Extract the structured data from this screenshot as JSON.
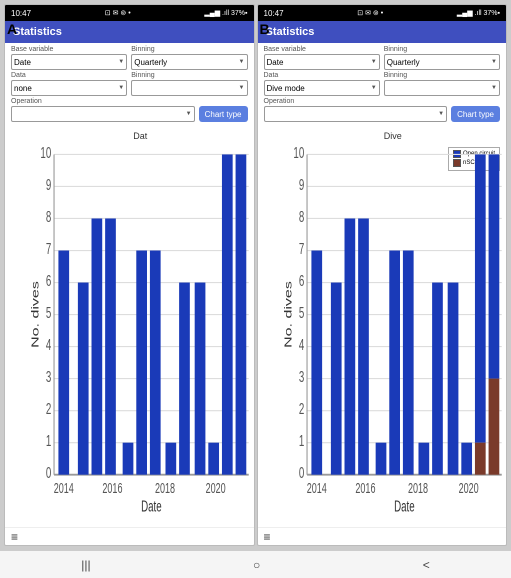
{
  "panels": [
    {
      "label": "A",
      "statusBar": {
        "time": "10:47",
        "icons": "⊡ ✉ ⊚",
        "signal": "📶 37%"
      },
      "titleBar": "Statistics",
      "controls": {
        "baseVariableLabel": "Base variable",
        "baseVariableValue": "Date",
        "binningLabel1": "Binning",
        "binningValue1": "Quarterly",
        "dataLabel": "Data",
        "dataValue": "none",
        "binningLabel2": "Binning",
        "binningValue2": "",
        "operationLabel": "Operation",
        "operationValue": "",
        "chartTypeBtn": "Chart type"
      },
      "chart": {
        "title": "Dat",
        "xLabel": "Date",
        "yLabel": "No. dives",
        "yMax": 10,
        "xLabels": [
          "2014",
          "2016",
          "2018",
          "2020",
          ""
        ],
        "bars": [
          {
            "x": 0.05,
            "height": 0.7,
            "color": "#1a3ab8"
          },
          {
            "x": 0.15,
            "height": 0.6,
            "color": "#1a3ab8"
          },
          {
            "x": 0.22,
            "height": 0.8,
            "color": "#1a3ab8"
          },
          {
            "x": 0.29,
            "height": 0.8,
            "color": "#1a3ab8"
          },
          {
            "x": 0.38,
            "height": 0.1,
            "color": "#1a3ab8"
          },
          {
            "x": 0.45,
            "height": 0.7,
            "color": "#1a3ab8"
          },
          {
            "x": 0.52,
            "height": 0.7,
            "color": "#1a3ab8"
          },
          {
            "x": 0.6,
            "height": 0.1,
            "color": "#1a3ab8"
          },
          {
            "x": 0.67,
            "height": 0.6,
            "color": "#1a3ab8"
          },
          {
            "x": 0.75,
            "height": 0.6,
            "color": "#1a3ab8"
          },
          {
            "x": 0.82,
            "height": 0.1,
            "color": "#1a3ab8"
          },
          {
            "x": 0.89,
            "height": 1.0,
            "color": "#1a3ab8"
          },
          {
            "x": 0.96,
            "height": 1.0,
            "color": "#1a3ab8"
          }
        ],
        "showLegend": false
      }
    },
    {
      "label": "B",
      "statusBar": {
        "time": "10:47",
        "icons": "⊡ ✉ ⊚",
        "signal": "📶 37%"
      },
      "titleBar": "Statistics",
      "controls": {
        "baseVariableLabel": "Base variable",
        "baseVariableValue": "Date",
        "binningLabel1": "Binning",
        "binningValue1": "Quarterly",
        "dataLabel": "Data",
        "dataValue": "Dive mode",
        "binningLabel2": "Binning",
        "binningValue2": "",
        "operationLabel": "Operation",
        "operationValue": "",
        "chartTypeBtn": "Chart type"
      },
      "chart": {
        "title": "Dive",
        "xLabel": "Date",
        "yLabel": "No. dives",
        "yMax": 10,
        "xLabels": [
          "2014",
          "2016",
          "2018",
          "2020",
          ""
        ],
        "bars": [
          {
            "x": 0.05,
            "heightBlue": 0.7,
            "heightBrown": 0.0,
            "color": "#1a3ab8"
          },
          {
            "x": 0.15,
            "heightBlue": 0.6,
            "heightBrown": 0.0
          },
          {
            "x": 0.22,
            "heightBlue": 0.8,
            "heightBrown": 0.0
          },
          {
            "x": 0.29,
            "heightBlue": 0.8,
            "heightBrown": 0.0
          },
          {
            "x": 0.38,
            "heightBlue": 0.1,
            "heightBrown": 0.0
          },
          {
            "x": 0.45,
            "heightBlue": 0.7,
            "heightBrown": 0.0
          },
          {
            "x": 0.52,
            "heightBlue": 0.7,
            "heightBrown": 0.0
          },
          {
            "x": 0.6,
            "heightBlue": 0.1,
            "heightBrown": 0.0
          },
          {
            "x": 0.67,
            "heightBlue": 0.6,
            "heightBrown": 0.0
          },
          {
            "x": 0.75,
            "heightBlue": 0.6,
            "heightBrown": 0.0
          },
          {
            "x": 0.82,
            "heightBlue": 0.1,
            "heightBrown": 0.0
          },
          {
            "x": 0.89,
            "heightBlue": 0.9,
            "heightBrown": 0.1
          },
          {
            "x": 0.96,
            "heightBlue": 0.7,
            "heightBrown": 0.3
          }
        ],
        "showLegend": true,
        "legend": [
          {
            "label": "Open circuit",
            "color": "#1a3ab8"
          },
          {
            "label": "nSCR",
            "color": "#7a3a2a"
          }
        ]
      }
    }
  ],
  "navBar": {
    "buttons": [
      "|||",
      "○",
      "<"
    ]
  }
}
